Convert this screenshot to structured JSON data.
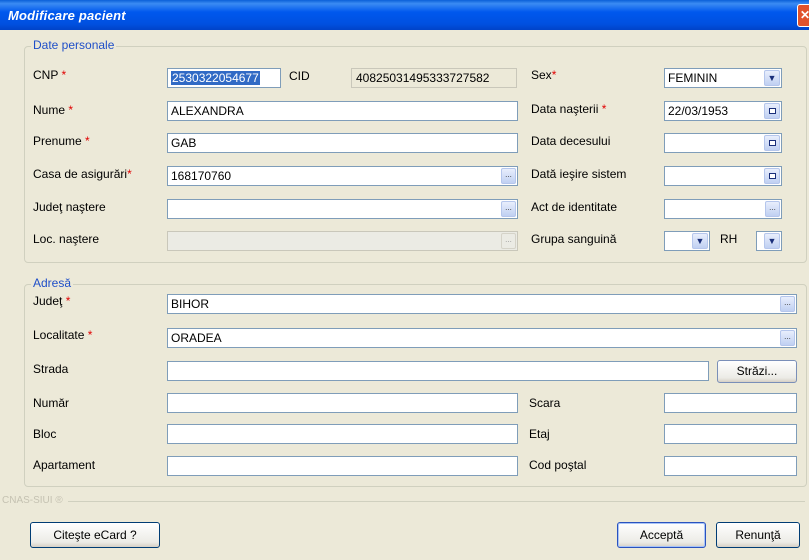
{
  "window": {
    "title": "Modificare pacient",
    "close_glyph": "✕"
  },
  "personal": {
    "legend": "Date personale",
    "cnp": {
      "label": "CNP",
      "value": "2530322054677"
    },
    "cid": {
      "label": "CID",
      "value": "40825031495333727582"
    },
    "nume": {
      "label": "Nume",
      "value": "ALEXANDRA"
    },
    "prenume": {
      "label": "Prenume",
      "value": "GAB"
    },
    "casa": {
      "label": "Casa de asigurări",
      "value": "168170760"
    },
    "judet_nastere": {
      "label": "Judeţ naştere",
      "value": ""
    },
    "loc_nastere": {
      "label": "Loc. naştere",
      "value": ""
    },
    "sex": {
      "label": "Sex",
      "value": "FEMININ"
    },
    "data_nasterii": {
      "label": "Data naşterii",
      "value": "22/03/1953"
    },
    "data_decesului": {
      "label": "Data decesului",
      "value": ""
    },
    "data_iesire": {
      "label": "Dată ieşire sistem",
      "value": ""
    },
    "act_identitate": {
      "label": "Act de identitate",
      "value": ""
    },
    "grupa": {
      "label": "Grupa sanguină",
      "value": ""
    },
    "rh": {
      "label": "RH",
      "value": ""
    }
  },
  "address": {
    "legend": "Adresă",
    "judet": {
      "label": "Judeţ",
      "value": "BIHOR"
    },
    "localitate": {
      "label": "Localitate",
      "value": "ORADEA"
    },
    "strada": {
      "label": "Strada",
      "value": ""
    },
    "strazi_button": "Străzi...",
    "numar": {
      "label": "Număr",
      "value": ""
    },
    "scara": {
      "label": "Scara",
      "value": ""
    },
    "bloc": {
      "label": "Bloc",
      "value": ""
    },
    "etaj": {
      "label": "Etaj",
      "value": ""
    },
    "apartament": {
      "label": "Apartament",
      "value": ""
    },
    "cod_postal": {
      "label": "Cod poştal",
      "value": ""
    }
  },
  "footer": {
    "brand": "CNAS-SIUI ®",
    "read_ecard": "Citeşte eCard ?",
    "accept": "Acceptă",
    "cancel": "Renunţă"
  },
  "icons": {
    "ellipsis": "...",
    "dropdown": "chevron-down-icon",
    "calendar": "calendar-icon"
  },
  "colors": {
    "title_bar": "#0058ee",
    "legend": "#1f4fc8",
    "required": "#e00000",
    "selection": "#316ac5"
  }
}
